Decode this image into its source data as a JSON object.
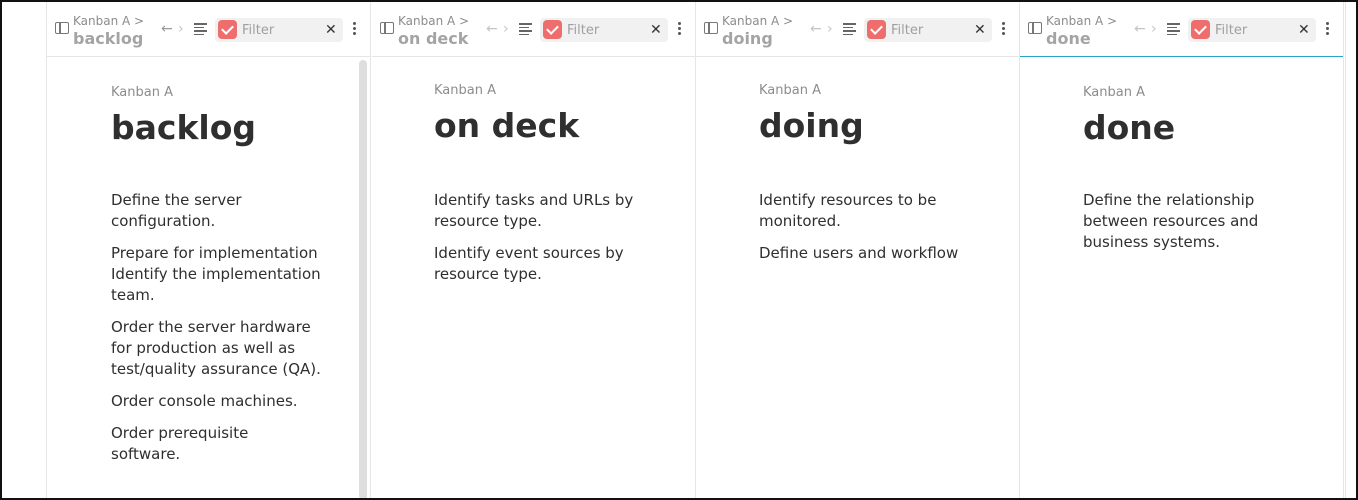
{
  "filter_placeholder": "Filter",
  "icons": {
    "sidebar": "sidebar-toggle-icon",
    "back": "arrow-left-icon",
    "forward": "arrow-right-icon",
    "lines": "align-lines-icon",
    "check": "checkbox-icon",
    "clear": "close-icon",
    "more": "more-vertical-icon"
  },
  "colors": {
    "check_accent": "#ee6e6e",
    "active_tab_underline": "#2aa3c9"
  },
  "panes": [
    {
      "breadcrumb": "Kanban A >",
      "tab_title": "backlog",
      "content_crumb": "Kanban A",
      "title": "backlog",
      "items": [
        "Define the server configuration.",
        "Prepare for implementation Identify the implementation team.",
        "Order the server hardware for production as well as test/quality assurance (QA).",
        "Order console machines.",
        "Order prerequisite software."
      ]
    },
    {
      "breadcrumb": "Kanban A >",
      "tab_title": "on deck",
      "content_crumb": "Kanban A",
      "title": "on deck",
      "items": [
        "Identify tasks and URLs by resource type.",
        "Identify event sources by resource type."
      ]
    },
    {
      "breadcrumb": "Kanban A >",
      "tab_title": "doing",
      "content_crumb": "Kanban A",
      "title": "doing",
      "items": [
        "Identify resources to be monitored.",
        "Define users and workflow"
      ]
    },
    {
      "breadcrumb": "Kanban A >",
      "tab_title": "done",
      "content_crumb": "Kanban A",
      "title": "done",
      "items": [
        "Define the relationship between resources and business systems."
      ]
    }
  ]
}
